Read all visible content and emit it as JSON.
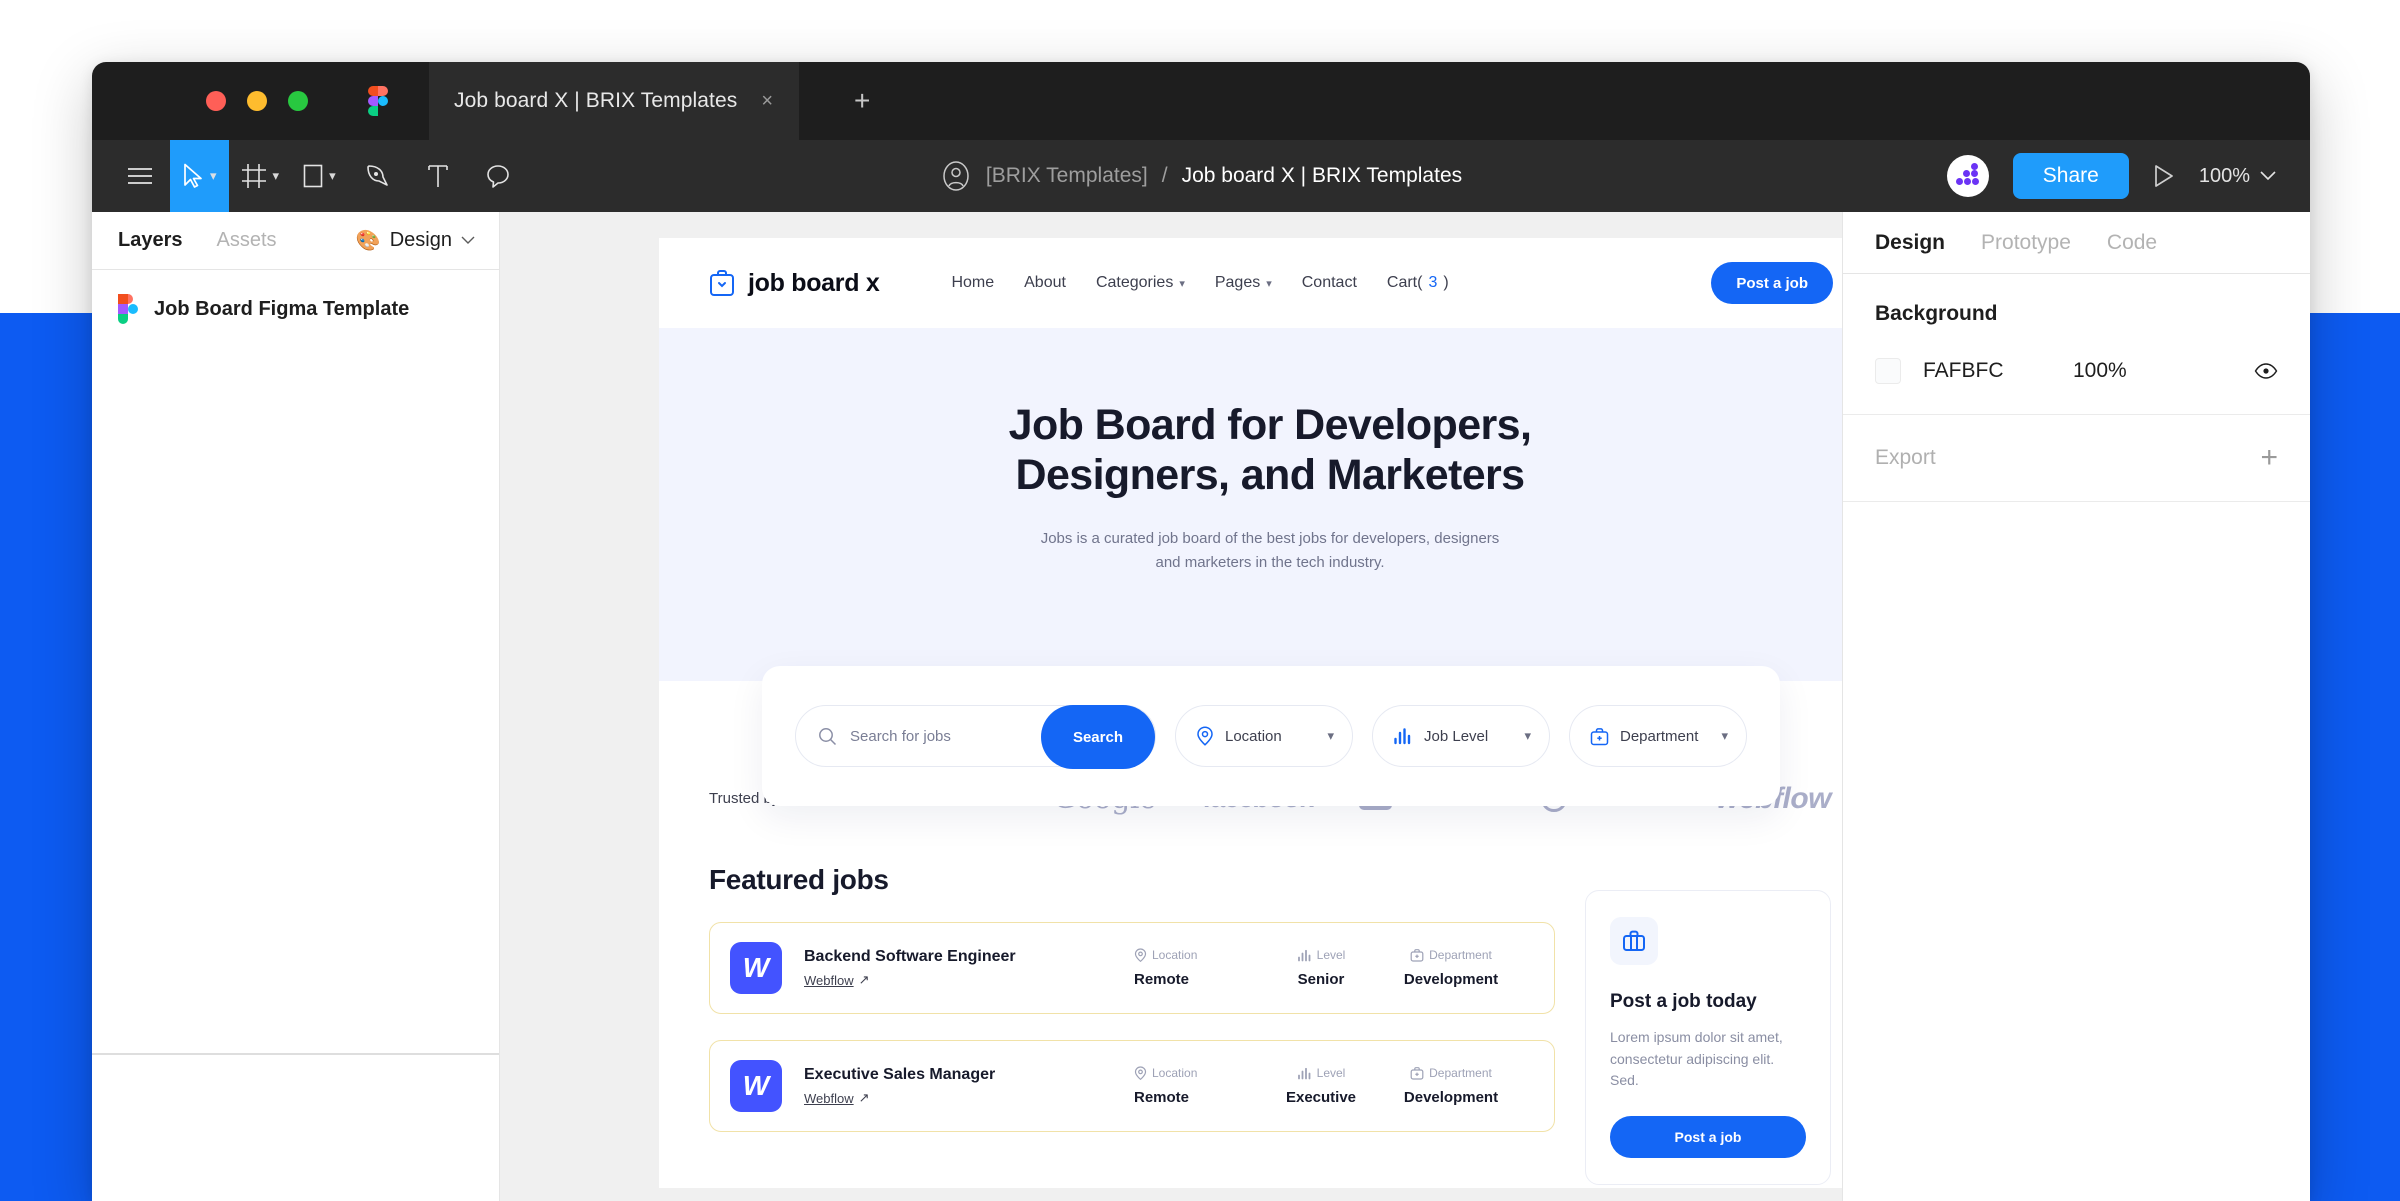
{
  "window": {
    "traffic_lights": [
      "close",
      "minimize",
      "maximize"
    ],
    "tab_title": "Job board X | BRIX Templates",
    "tab_close_glyph": "×",
    "new_tab_glyph": "+"
  },
  "toolbar": {
    "tools": [
      {
        "name": "menu-icon",
        "label": "Menu"
      },
      {
        "name": "move-tool-icon",
        "label": "Move"
      },
      {
        "name": "frame-tool-icon",
        "label": "Frame"
      },
      {
        "name": "shape-tool-icon",
        "label": "Shape"
      },
      {
        "name": "pen-tool-icon",
        "label": "Pen"
      },
      {
        "name": "text-tool-icon",
        "label": "Text"
      },
      {
        "name": "comment-tool-icon",
        "label": "Comment"
      }
    ],
    "breadcrumb": {
      "project": "[BRIX Templates]",
      "separator": "/",
      "file": "Job board X | BRIX Templates"
    },
    "share_label": "Share",
    "zoom_level": "100%",
    "zoom_caret": "⌄"
  },
  "left_panel": {
    "tabs": [
      {
        "label": "Layers",
        "active": true
      },
      {
        "label": "Assets",
        "active": false
      }
    ],
    "design_switch": {
      "label": "Design",
      "icon": "🎨",
      "caret": "⌄"
    },
    "layers": [
      {
        "label": "Job Board Figma Template",
        "icon": "figma-file-icon"
      }
    ]
  },
  "right_panel": {
    "tabs": [
      {
        "label": "Design",
        "active": true
      },
      {
        "label": "Prototype",
        "active": false
      },
      {
        "label": "Code",
        "active": false
      }
    ],
    "background": {
      "title": "Background",
      "hex": "FAFBFC",
      "opacity": "100%",
      "swatch_color": "#FAFBFC"
    },
    "export": {
      "label": "Export",
      "plus": "+"
    }
  },
  "site": {
    "nav": {
      "logo_text": "job board x",
      "items": [
        {
          "label": "Home",
          "caret": false
        },
        {
          "label": "About",
          "caret": false
        },
        {
          "label": "Categories",
          "caret": true
        },
        {
          "label": "Pages",
          "caret": true
        },
        {
          "label": "Contact",
          "caret": false
        }
      ],
      "cart_label": "Cart(",
      "cart_count": "3",
      "cart_label_end": ")",
      "cta": "Post a job"
    },
    "hero": {
      "heading_line1": "Job Board for Developers,",
      "heading_line2": "Designers, and Marketers",
      "subtext": "Jobs is a curated job board of the best jobs for developers, designers and marketers in the tech industry."
    },
    "search": {
      "placeholder": "Search for jobs",
      "button": "Search",
      "filters": [
        {
          "label": "Location",
          "icon": "location-pin-icon"
        },
        {
          "label": "Job Level",
          "icon": "bar-chart-icon"
        },
        {
          "label": "Department",
          "icon": "briefcase-icon"
        }
      ],
      "caret": "⌄"
    },
    "trusted": {
      "label": "Trusted by",
      "logos": [
        "Google",
        "facebook",
        "YouTube",
        "Pinterest",
        "webflow"
      ]
    },
    "featured": {
      "title": "Featured jobs",
      "col_headers": {
        "location": "Location",
        "level": "Level",
        "department": "Department"
      },
      "jobs": [
        {
          "logo_letter": "W",
          "title": "Backend Software Engineer",
          "company": "Webflow",
          "company_arrow": "↗",
          "location": "Remote",
          "level": "Senior",
          "department": "Development"
        },
        {
          "logo_letter": "W",
          "title": "Executive Sales Manager",
          "company": "Webflow",
          "company_arrow": "↗",
          "location": "Remote",
          "level": "Executive",
          "department": "Development"
        }
      ]
    },
    "promo": {
      "icon": "briefcase-icon",
      "title": "Post a job today",
      "text": "Lorem ipsum dolor sit amet, consectetur adipiscing elit. Sed.",
      "button": "Post a job"
    }
  },
  "colors": {
    "brand_blue": "#1466F5",
    "figma_accent": "#1F9CFB",
    "page_blue": "#0D5BF2",
    "webflow_indigo": "#4353FF",
    "job_card_border": "#F1E2A8"
  }
}
